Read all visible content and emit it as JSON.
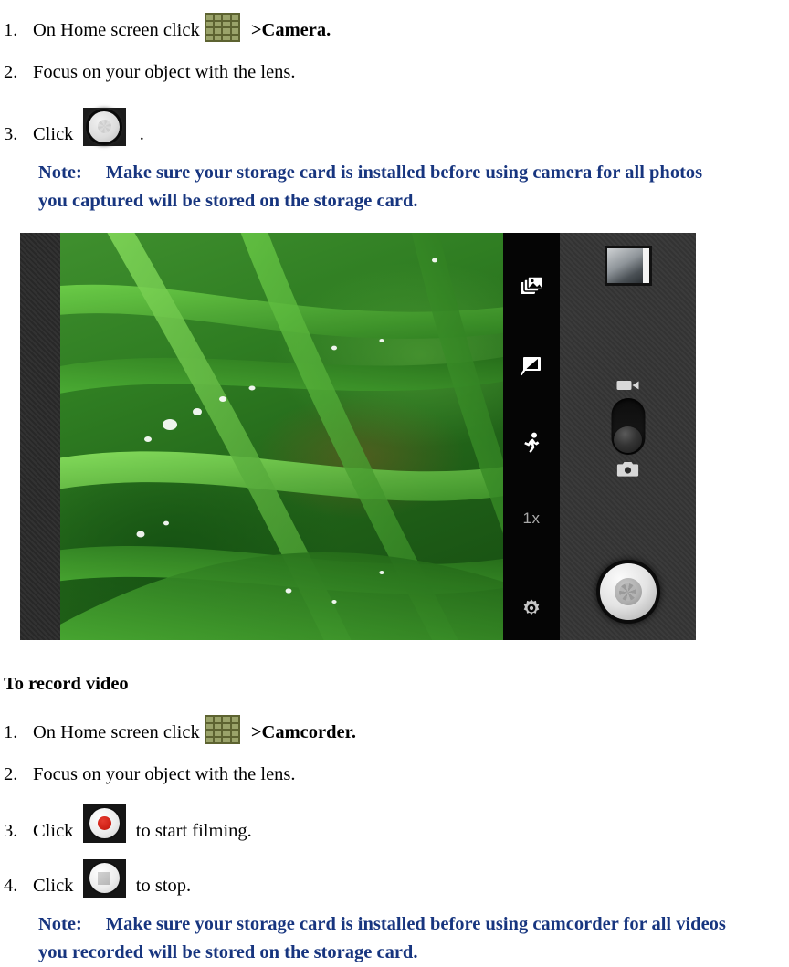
{
  "photo_section": {
    "steps": [
      {
        "num": "1.",
        "text_before": "On Home screen click ",
        "icon": "app-drawer-grid-icon",
        "text_after": ">Camera.",
        "after_bold": true
      },
      {
        "num": "2.",
        "text_before": "Focus on your object with the lens.",
        "icon": null,
        "text_after": "",
        "after_bold": false
      },
      {
        "num": "3.",
        "text_before": "Click  ",
        "icon": "camera-shutter-icon",
        "text_after": " .",
        "after_bold": false
      }
    ],
    "note": {
      "label": "Note:",
      "line1": "Make sure your storage card is installed before using camera for all photos",
      "line2": "you captured will be stored on the storage card."
    }
  },
  "figure": {
    "name": "camera-app-screenshot",
    "viewfinder_subject": "close-up of green grass blades with dew drops",
    "settings_strip": {
      "items": [
        {
          "name": "gallery-stack-icon",
          "label": ""
        },
        {
          "name": "picture-effects-icon",
          "label": ""
        },
        {
          "name": "scene-mode-running-icon",
          "label": ""
        },
        {
          "name": "zoom-level-label",
          "label": "1x"
        },
        {
          "name": "settings-gear-icon",
          "label": ""
        }
      ]
    },
    "controls": {
      "thumbnail": "last-photo-thumbnail",
      "mode_toggle": {
        "top_icon": "camcorder-icon",
        "bottom_icon": "camera-icon",
        "knob_position": "bottom"
      },
      "shutter": "shutter-button"
    }
  },
  "video_section": {
    "heading": "To record video",
    "steps": [
      {
        "num": "1.",
        "text_before": "On Home screen click ",
        "icon": "app-drawer-grid-icon",
        "text_after": ">Camcorder.",
        "after_bold": true
      },
      {
        "num": "2.",
        "text_before": "Focus on your object with the lens.",
        "icon": null,
        "text_after": "",
        "after_bold": false
      },
      {
        "num": "3.",
        "text_before": "Click  ",
        "icon": "record-button-icon",
        "text_after": " to start filming.",
        "after_bold": false
      },
      {
        "num": "4.",
        "text_before": "Click  ",
        "icon": "stop-button-icon",
        "text_after": " to stop.",
        "after_bold": false
      }
    ],
    "note": {
      "label": "Note:",
      "line1": "Make sure your storage card is installed before using camcorder for all videos",
      "line2": "you recorded will be stored on the storage card."
    }
  },
  "colors": {
    "note_blue": "#17357f",
    "body_text": "#000000",
    "grid_icon_bg": "#5d6331",
    "grid_icon_cell": "#9aa36a",
    "record_red": "#cc1f14"
  }
}
